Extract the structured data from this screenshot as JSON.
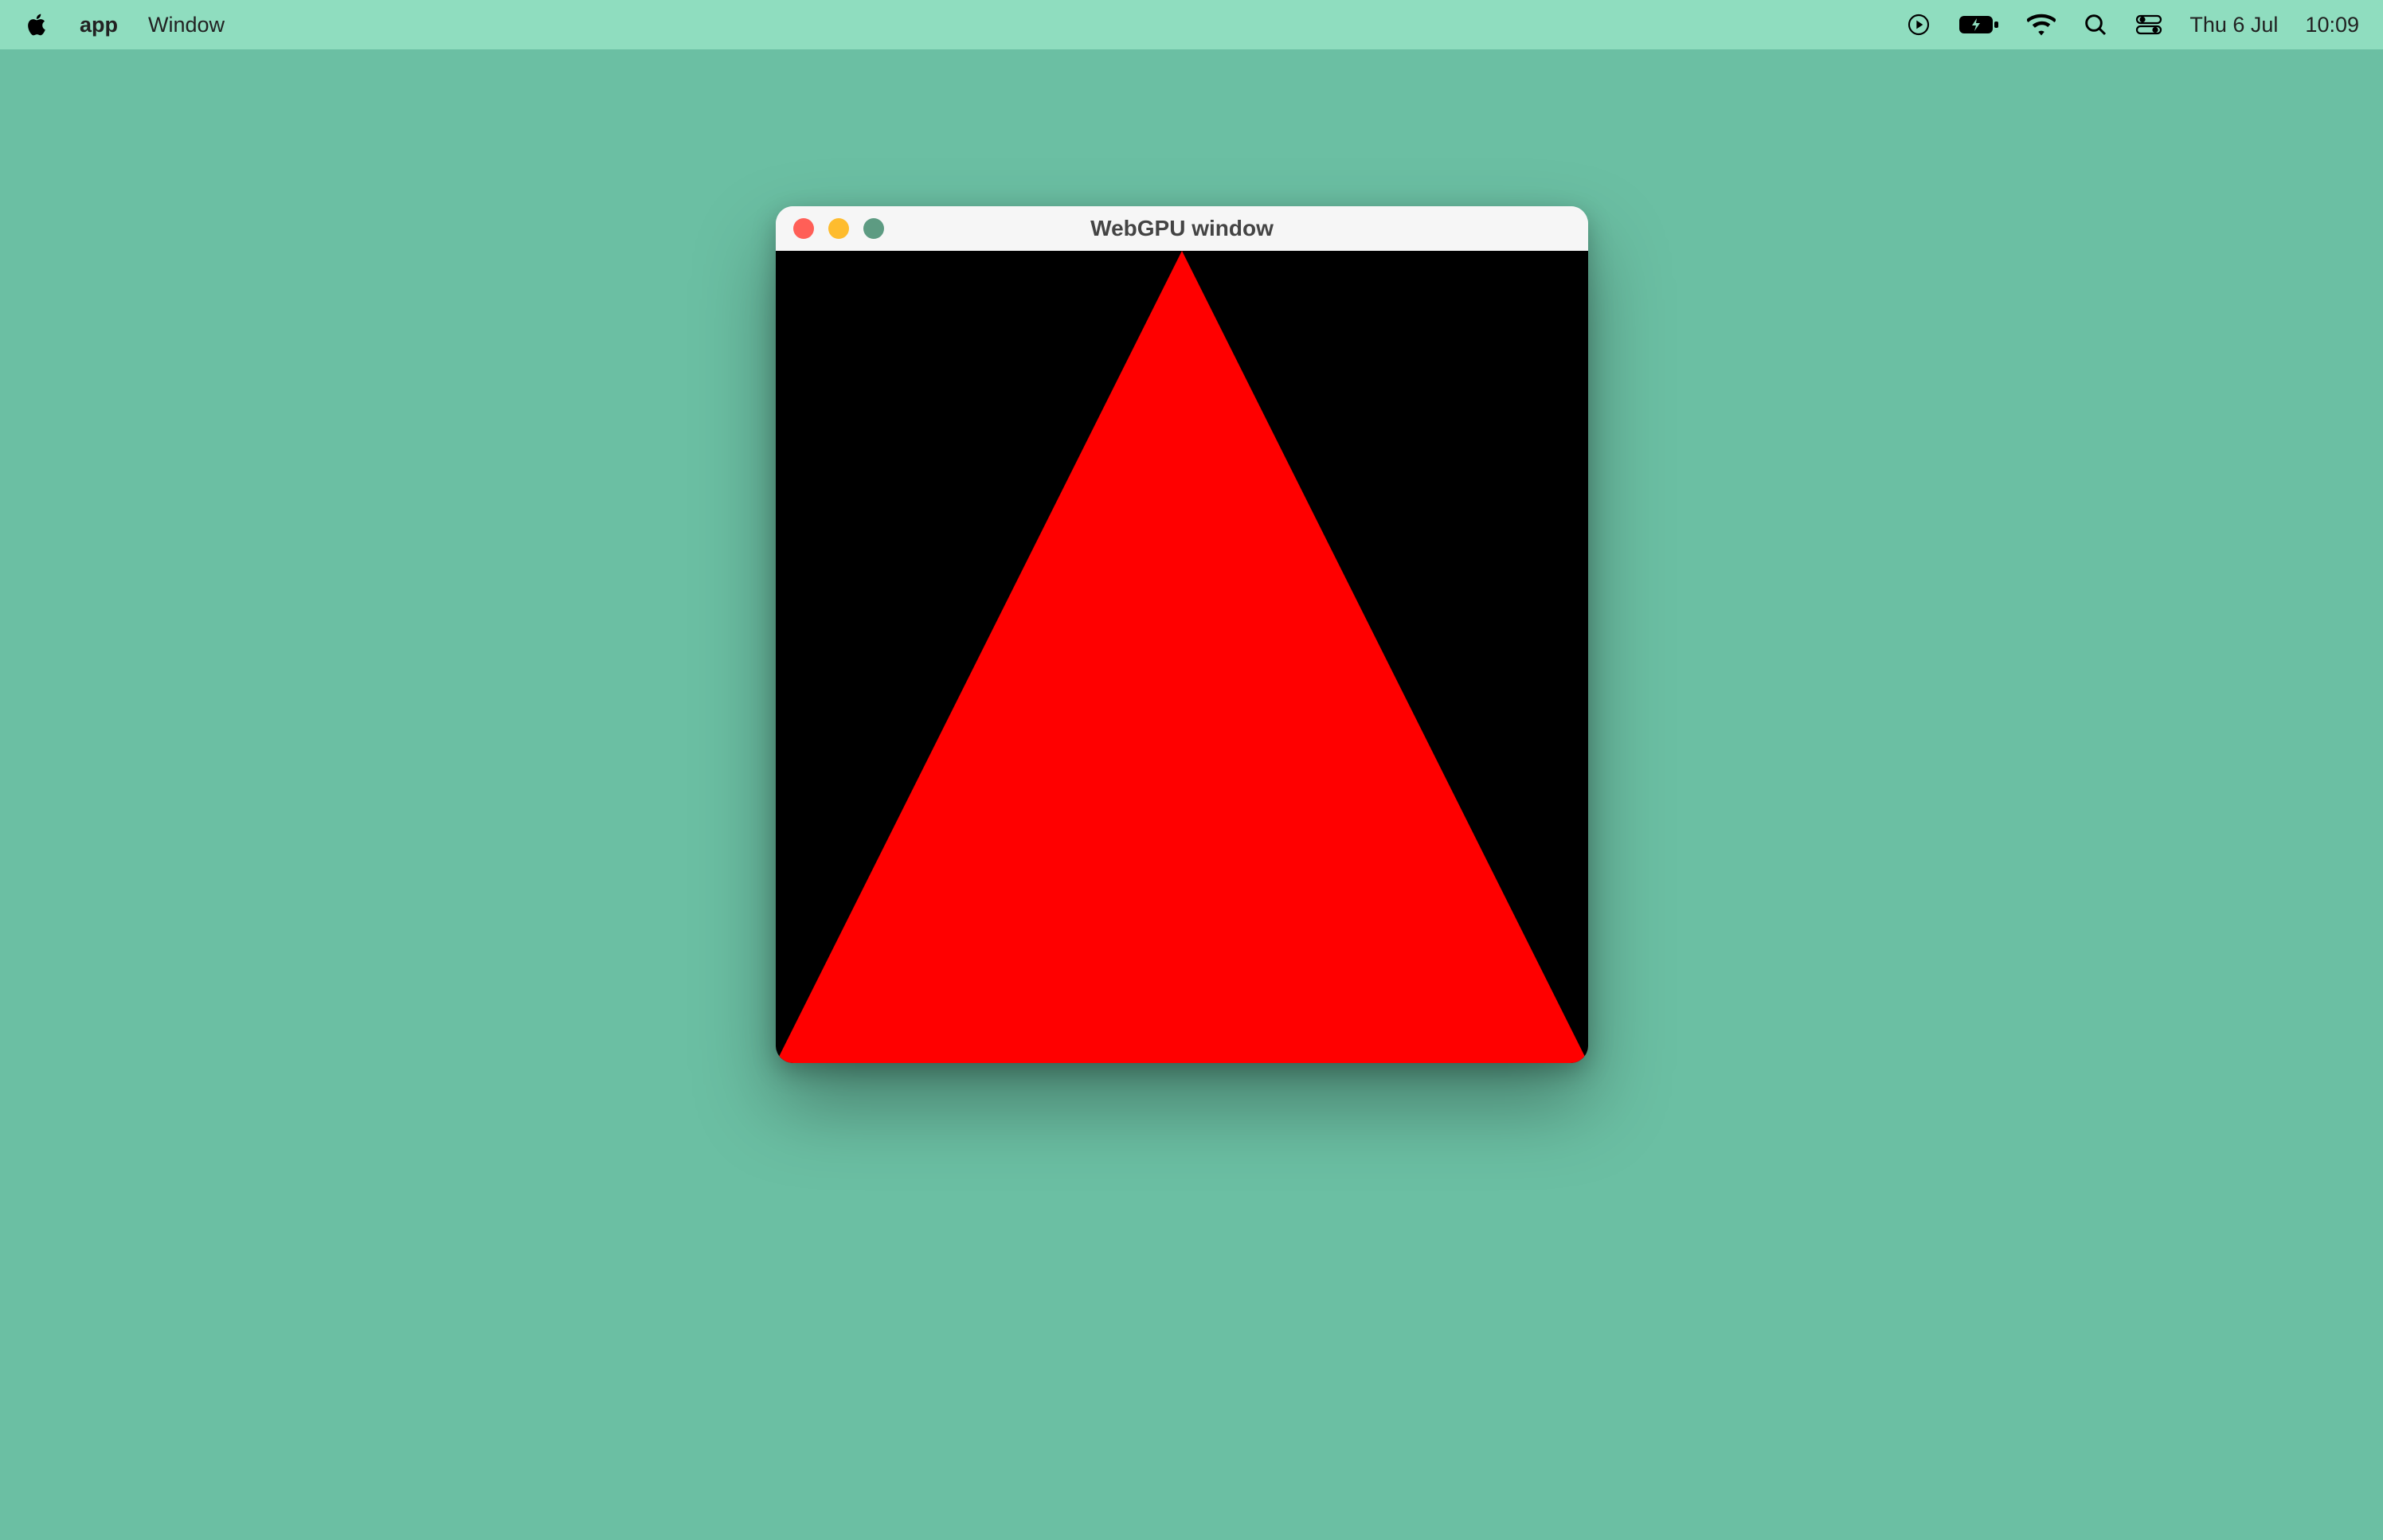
{
  "menubar": {
    "app_name": "app",
    "menus": [
      "Window"
    ],
    "date": "Thu 6 Jul",
    "time": "10:09"
  },
  "window": {
    "title": "WebGPU window",
    "canvas": {
      "background_color": "#000000",
      "shape": {
        "type": "triangle",
        "color": "#FF0000",
        "vertices": [
          [
            0.5,
            0.0
          ],
          [
            0.0,
            1.0
          ],
          [
            1.0,
            1.0
          ]
        ]
      }
    }
  },
  "colors": {
    "desktop_bg": "#6BBFA3",
    "menubar_bg": "#8FDDBF",
    "traffic_close": "#FF5F57",
    "traffic_min": "#FEBC2E",
    "traffic_max": "#5D9B82"
  }
}
